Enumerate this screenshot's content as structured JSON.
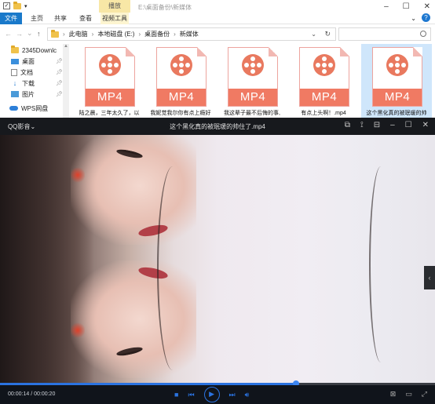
{
  "explorer": {
    "title_path": "E:\\桌面备份\\新媒体",
    "context_tab": "播放",
    "ribbon_tabs": {
      "file": "文件",
      "main": "主页",
      "share": "共享",
      "view": "查看",
      "video_tools": "视频工具"
    },
    "nav": {
      "back": "←",
      "forward": "→",
      "recent": "⌄",
      "up": "↑"
    },
    "breadcrumb": [
      "此电脑",
      "本地磁盘 (E:)",
      "桌面备份",
      "新媒体"
    ],
    "sidebar": [
      {
        "label": "2345Downlc",
        "icon": "folder-icon"
      },
      {
        "label": "桌面",
        "icon": "desktop-icon",
        "pinned": true
      },
      {
        "label": "文档",
        "icon": "document-icon",
        "pinned": true
      },
      {
        "label": "下载",
        "icon": "download-icon",
        "pinned": true
      },
      {
        "label": "图片",
        "icon": "picture-icon",
        "pinned": true
      },
      {
        "label": "WPS网盘",
        "icon": "cloud-icon"
      }
    ],
    "files": [
      {
        "badge": "MP4",
        "name": "陆之晨，三年太久了，以",
        "selected": false
      },
      {
        "badge": "MP4",
        "name": "我妮觉我尔你有点上瘾好",
        "selected": false
      },
      {
        "badge": "MP4",
        "name": "我这辈子最不后悔的事,",
        "selected": false
      },
      {
        "badge": "MP4",
        "name": "有点上头啊！.mp4",
        "selected": false
      },
      {
        "badge": "MP4",
        "name": "这个黑化真的被珉瑗的帅",
        "selected": true
      }
    ]
  },
  "player": {
    "app_name": "QQ影音⌄",
    "file_title": "这个黑化真的被珉瑗的帅住了.mp4",
    "time": "00:00:14 / 00:00:20",
    "progress": 0.68,
    "colors": {
      "accent": "#2b73e0",
      "bg": "#10141b"
    }
  }
}
